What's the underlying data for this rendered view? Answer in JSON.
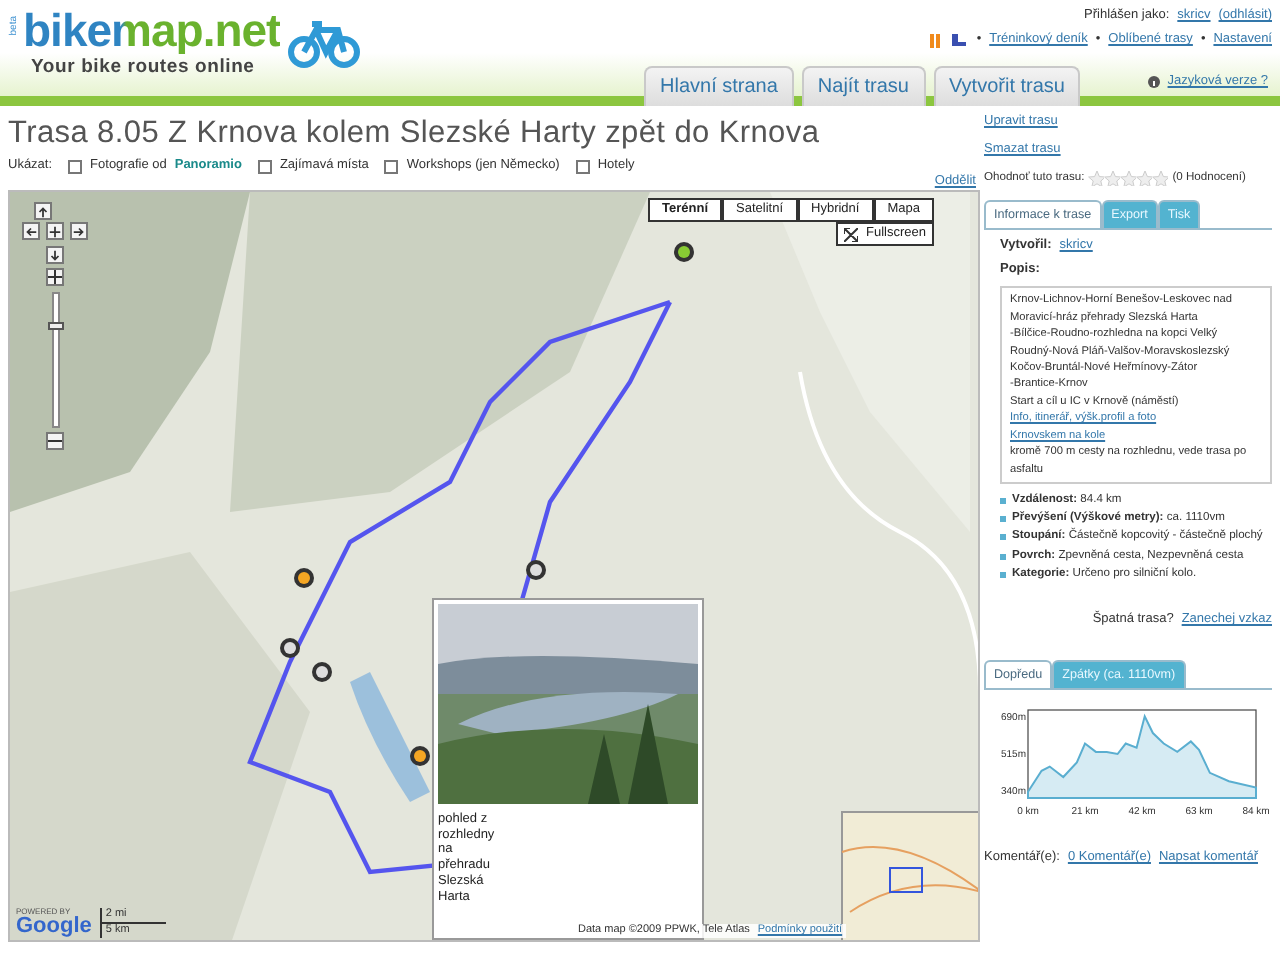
{
  "header": {
    "logo": {
      "beta": "beta",
      "name": "bikemap.net",
      "tagline": "Your bike routes online"
    },
    "user": {
      "prefix": "Přihlášen jako:",
      "username": "skricv",
      "logout": "(odhlásit)"
    },
    "separator": "•",
    "user_links": [
      "Tréninkový deník",
      "Oblíbené trasy",
      "Nastavení"
    ],
    "nav": [
      {
        "label": "Hlavní strana",
        "selected": false
      },
      {
        "label": "Najít trasu",
        "selected": false
      },
      {
        "label": "Vytvořit trasu",
        "selected": false
      }
    ],
    "language": "Jazyková verze ?"
  },
  "route": {
    "title": "Trasa 8.05 Z Krnova kolem Slezské Harty zpět do Krnova",
    "show_label": "Ukázat:",
    "filters": [
      {
        "label": "Fotografie od",
        "brand": "Panoramio",
        "checked": false
      },
      {
        "label": "Zajímavá místa",
        "checked": false
      },
      {
        "label": "Workshops (jen Německo)",
        "checked": false
      },
      {
        "label": "Hotely",
        "checked": false
      }
    ],
    "detach": "Oddělit"
  },
  "map": {
    "types": [
      {
        "label": "Terénní",
        "selected": true
      },
      {
        "label": "Satelitní",
        "selected": false
      },
      {
        "label": "Hybridní",
        "selected": false
      },
      {
        "label": "Mapa",
        "selected": false
      }
    ],
    "fullscreen": "Fullscreen",
    "zoom": {
      "level": 0.78
    },
    "popup": {
      "text": "pohled z rozhledny na přehradu Slezská Harta"
    },
    "powered": "POWERED BY",
    "google": "Google",
    "scale": [
      "2 mi",
      "5 km"
    ],
    "copyright": "Data map ©2009 PPWK, Tele Atlas",
    "terms": "Podmínky použití"
  },
  "sidebar": {
    "links": [
      "Upravit trasu",
      "Smazat trasu"
    ],
    "rate_label": "Ohodnoť tuto trasu:",
    "stars": 0,
    "rating_count": "(0 Hodnocení)",
    "tabs": [
      {
        "label": "Informace k trase",
        "selected": true
      },
      {
        "label": "Export",
        "selected": false
      },
      {
        "label": "Tisk",
        "selected": false
      }
    ],
    "author_label": "Vytvořil:",
    "author": "skricv",
    "description_label": "Popis:",
    "description": [
      {
        "kind": "text",
        "text": "Krnov-Lichnov-Horní Benešov-Leskovec nad Moravicí-hráz přehrady Slezská Harta"
      },
      {
        "kind": "text",
        "text": "-Bílčice-Roudno-rozhledna na kopci Velký Roudný-Nová Pláň-Valšov-Moravskoslezský Kočov-Bruntál-Nové Heřmínovy-Zátor"
      },
      {
        "kind": "text",
        "text": "-Brantice-Krnov"
      },
      {
        "kind": "text",
        "text": "Start a cíl u IC v Krnově (náměstí)"
      },
      {
        "kind": "link",
        "text": "Info, itinerář, výšk.profil a foto"
      },
      {
        "kind": "link",
        "text": "Krnovskem na kole"
      },
      {
        "kind": "text",
        "text": "kromě 700 m cesty na rozhlednu, vede trasa po asfaltu"
      }
    ],
    "facts": [
      "**Vzdálenost:** 84.4 km",
      "**Převýšení (Výškové metry):** ca. 1110vm",
      "**Stoupání:** Částečně kopcovitý - částečně plochý",
      "**Povrch:** Zpevněná cesta, Nezpevněná cesta",
      "**Kategorie:** Určeno pro silniční kolo."
    ],
    "report_label": "Špatná trasa?",
    "report_link": "Zanechej vzkaz",
    "profile_tabs": [
      {
        "label": "Dopředu",
        "selected": true
      },
      {
        "label": "Zpátky (ca. 1110vm)",
        "selected": false
      }
    ],
    "chart_data": {
      "type": "area",
      "x": [
        0,
        5,
        8,
        13,
        18,
        21,
        25,
        29,
        33,
        36,
        40,
        43,
        46,
        50,
        55,
        60,
        63,
        67,
        74,
        84
      ],
      "series": [
        {
          "color": "#5aaed0",
          "values": [
            330,
            430,
            450,
            400,
            470,
            560,
            520,
            520,
            510,
            560,
            540,
            690,
            610,
            560,
            520,
            570,
            530,
            420,
            380,
            350
          ]
        }
      ],
      "xlim": [
        0,
        84
      ],
      "ylim": [
        300,
        720
      ],
      "xticks": [
        {
          "value": 0,
          "label": "0 km"
        },
        {
          "value": 21,
          "label": "21 km"
        },
        {
          "value": 42,
          "label": "42 km"
        },
        {
          "value": 63,
          "label": "63 km"
        },
        {
          "value": 84,
          "label": "84 km"
        }
      ],
      "yticks": [
        {
          "value": 340,
          "label": "340m"
        },
        {
          "value": 515,
          "label": "515m"
        },
        {
          "value": 690,
          "label": "690m"
        }
      ]
    },
    "comments_label": "Komentář(e):",
    "comments_count": "0 Komentář(e)",
    "comments_write": "Napsat komentář"
  }
}
